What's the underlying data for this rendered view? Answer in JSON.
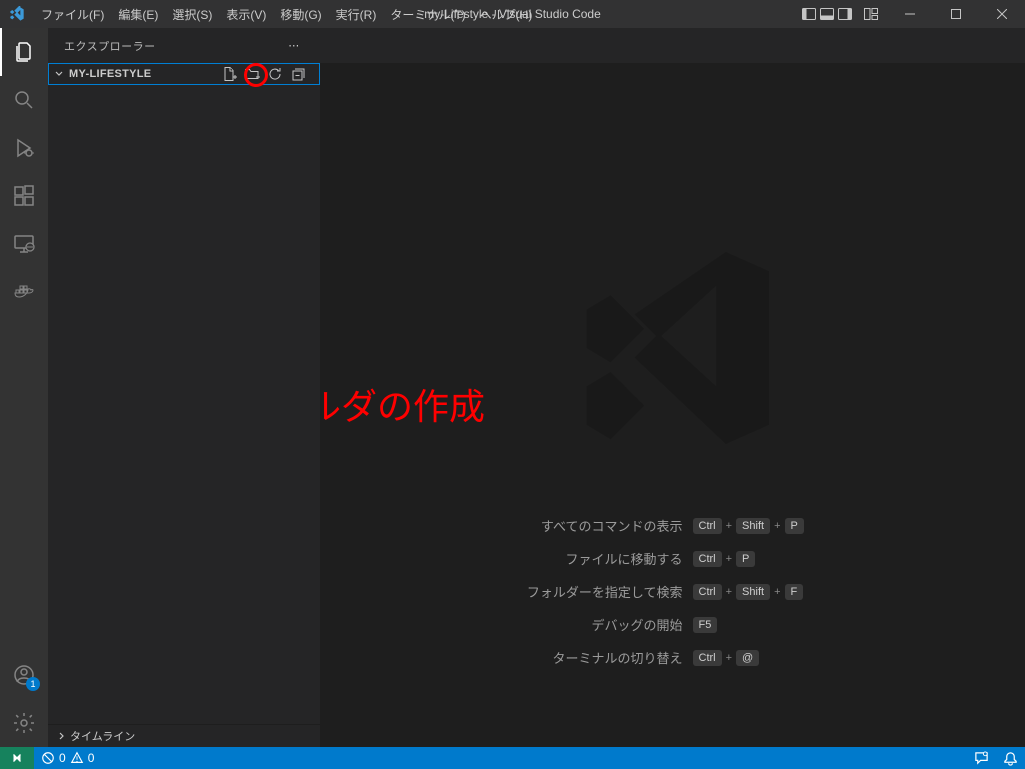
{
  "titlebar": {
    "menu": [
      "ファイル(F)",
      "編集(E)",
      "選択(S)",
      "表示(V)",
      "移動(G)",
      "実行(R)",
      "ターミナル(T)",
      "ヘルプ(H)"
    ],
    "title": "my-Lifestyle - Visual Studio Code"
  },
  "activitybar": {
    "items": [
      {
        "name": "explorer",
        "active": true
      },
      {
        "name": "search",
        "active": false
      },
      {
        "name": "debug",
        "active": false
      },
      {
        "name": "extensions",
        "active": false
      },
      {
        "name": "remote-explorer",
        "active": false
      },
      {
        "name": "docker",
        "active": false
      }
    ],
    "bottom": [
      {
        "name": "accounts",
        "badge": "1"
      },
      {
        "name": "settings"
      }
    ]
  },
  "sidebar": {
    "title": "エクスプローラー",
    "folder": "MY-LIFESTYLE",
    "actions": [
      "new-file-icon",
      "new-folder-icon",
      "refresh-icon",
      "collapse-all-icon"
    ],
    "footer": "タイムライン"
  },
  "annotation": {
    "text": "新しいフォルダの作成"
  },
  "shortcuts": [
    {
      "label": "すべてのコマンドの表示",
      "keys": [
        "Ctrl",
        "Shift",
        "P"
      ]
    },
    {
      "label": "ファイルに移動する",
      "keys": [
        "Ctrl",
        "P"
      ]
    },
    {
      "label": "フォルダーを指定して検索",
      "keys": [
        "Ctrl",
        "Shift",
        "F"
      ]
    },
    {
      "label": "デバッグの開始",
      "keys": [
        "F5"
      ]
    },
    {
      "label": "ターミナルの切り替え",
      "keys": [
        "Ctrl",
        "@"
      ]
    }
  ],
  "statusbar": {
    "errors": "0",
    "warnings": "0"
  }
}
